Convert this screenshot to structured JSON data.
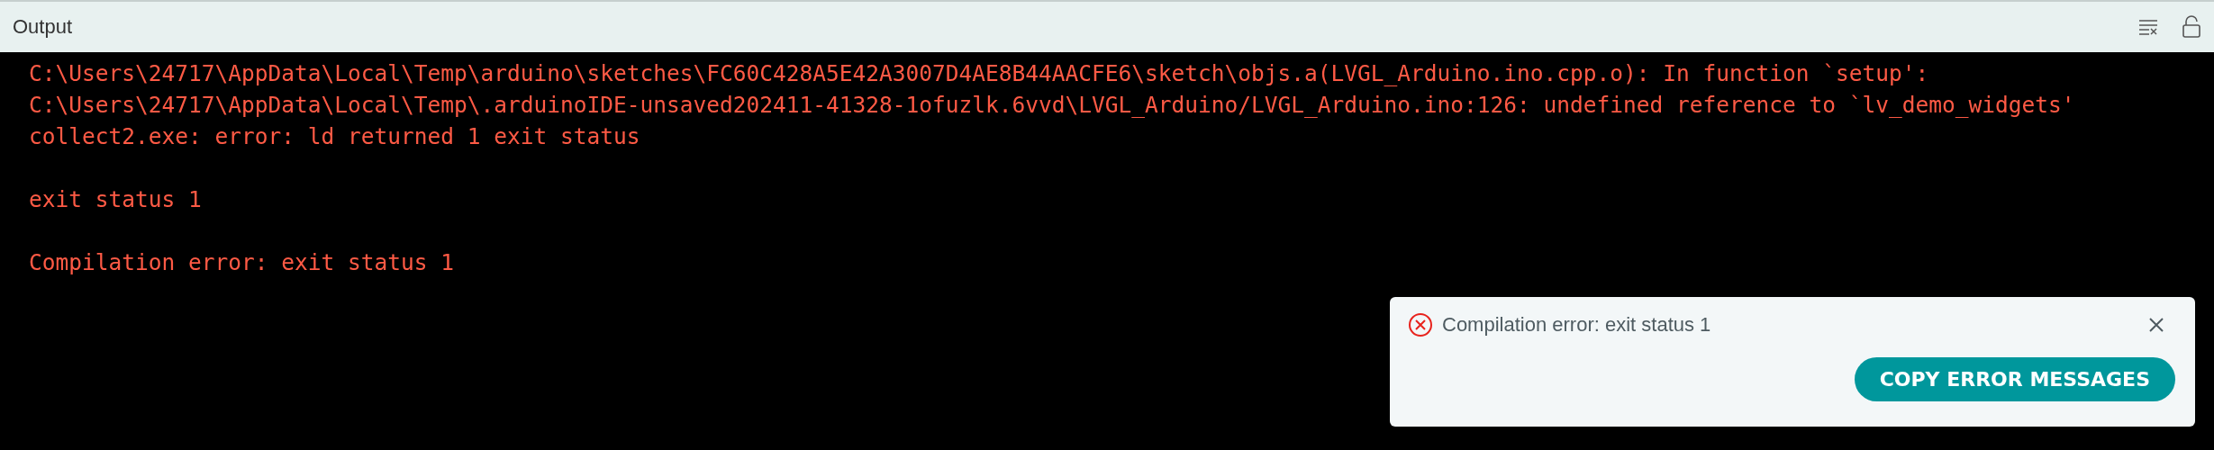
{
  "panel": {
    "title": "Output"
  },
  "output_blocks": [
    [
      "C:\\Users\\24717\\AppData\\Local\\Temp\\arduino\\sketches\\FC60C428A5E42A3007D4AE8B44AACFE6\\sketch\\objs.a(LVGL_Arduino.ino.cpp.o): In function `setup':",
      "C:\\Users\\24717\\AppData\\Local\\Temp\\.arduinoIDE-unsaved202411-41328-1ofuzlk.6vvd\\LVGL_Arduino/LVGL_Arduino.ino:126: undefined reference to `lv_demo_widgets'",
      "collect2.exe: error: ld returned 1 exit status"
    ],
    [
      "exit status 1"
    ],
    [
      "Compilation error: exit status 1"
    ]
  ],
  "notification": {
    "message": "Compilation error: exit status 1",
    "button": "COPY ERROR MESSAGES"
  }
}
